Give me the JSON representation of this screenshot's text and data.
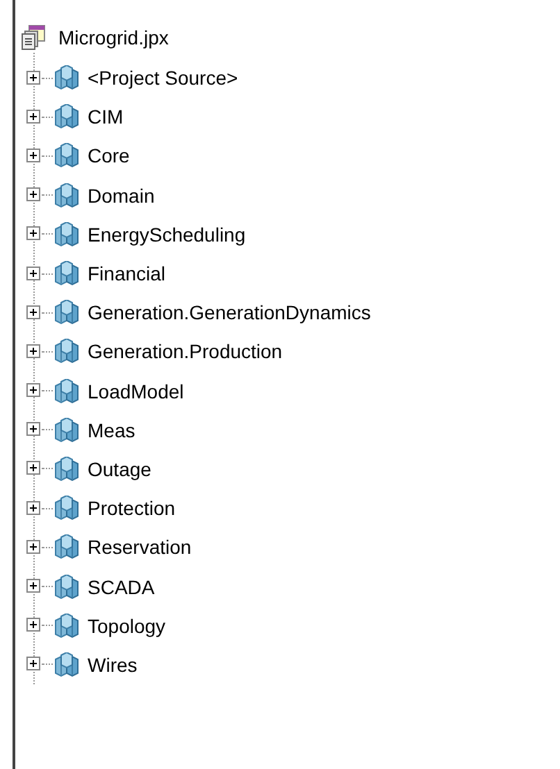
{
  "tree": {
    "root": {
      "label": "Microgrid.jpx"
    },
    "children": [
      {
        "label": "<Project Source>",
        "expanded": false
      },
      {
        "label": "CIM",
        "expanded": false
      },
      {
        "label": "Core",
        "expanded": false
      },
      {
        "label": "Domain",
        "expanded": false
      },
      {
        "label": "EnergyScheduling",
        "expanded": false
      },
      {
        "label": "Financial",
        "expanded": false
      },
      {
        "label": "Generation.GenerationDynamics",
        "expanded": false
      },
      {
        "label": "Generation.Production",
        "expanded": false
      },
      {
        "label": "LoadModel",
        "expanded": false
      },
      {
        "label": "Meas",
        "expanded": false
      },
      {
        "label": "Outage",
        "expanded": false
      },
      {
        "label": "Protection",
        "expanded": false
      },
      {
        "label": "Reservation",
        "expanded": false
      },
      {
        "label": "SCADA",
        "expanded": false
      },
      {
        "label": "Topology",
        "expanded": false
      },
      {
        "label": "Wires",
        "expanded": false
      }
    ]
  }
}
